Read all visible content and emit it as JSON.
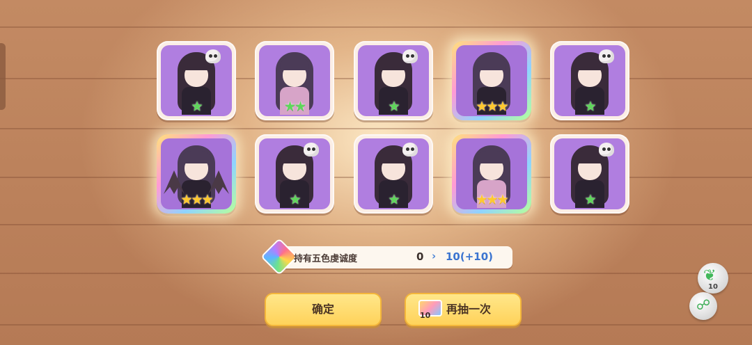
{
  "results": [
    {
      "name": "skull-girl",
      "stars": 1,
      "rarity": "common"
    },
    {
      "name": "maid-girl",
      "stars": 2,
      "rarity": "common"
    },
    {
      "name": "skull-girl",
      "stars": 1,
      "rarity": "common"
    },
    {
      "name": "masked-girl",
      "stars": 3,
      "rarity": "rare"
    },
    {
      "name": "skull-girl",
      "stars": 1,
      "rarity": "common"
    },
    {
      "name": "bat-wing-girl",
      "stars": 3,
      "rarity": "rare"
    },
    {
      "name": "skull-girl",
      "stars": 1,
      "rarity": "common"
    },
    {
      "name": "skull-girl",
      "stars": 1,
      "rarity": "common"
    },
    {
      "name": "glasses-girl",
      "stars": 3,
      "rarity": "rare"
    },
    {
      "name": "skull-girl",
      "stars": 1,
      "rarity": "common"
    }
  ],
  "currency": {
    "label": "持有五色虔诚度",
    "from": "0",
    "arrow": "›",
    "to": "10(+10)"
  },
  "buttons": {
    "confirm": "确定",
    "again": "再抽一次",
    "again_ticket_count": "10"
  },
  "side": {
    "leaf_count": "10",
    "leaf_icon": "leaf-icon",
    "link_icon": "link-icon"
  },
  "colors": {
    "card_purple": "#b07ee0",
    "star_green": "#5ed65a",
    "star_gold": "#ffc92e",
    "button_yellow": "#ffd25a",
    "accent_blue": "#3b74d0"
  }
}
